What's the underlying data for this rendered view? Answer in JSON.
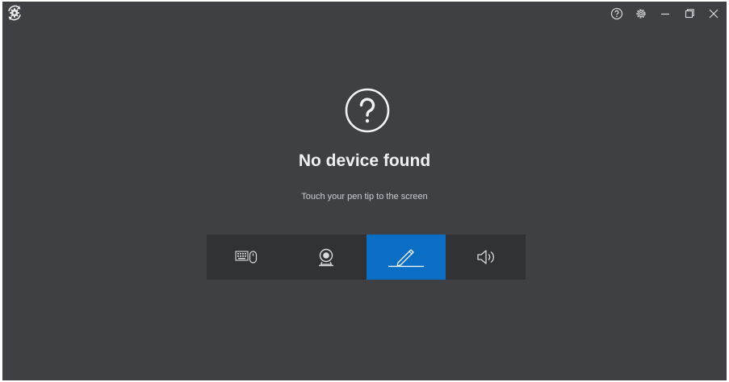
{
  "window": {
    "logo_icon": "gear-sync-icon",
    "controls": [
      {
        "icon": "help-icon"
      },
      {
        "icon": "settings-icon"
      },
      {
        "icon": "minimize-icon"
      },
      {
        "icon": "maximize-icon"
      },
      {
        "icon": "close-icon"
      }
    ]
  },
  "status": {
    "icon": "question-circle-icon",
    "title": "No device found",
    "hint": "Touch your pen tip to the screen"
  },
  "device_tabs": {
    "items": [
      {
        "icon": "keyboard-mouse-icon",
        "active": false
      },
      {
        "icon": "webcam-icon",
        "active": false
      },
      {
        "icon": "pen-icon",
        "active": true
      },
      {
        "icon": "speaker-icon",
        "active": false
      }
    ]
  },
  "colors": {
    "background": "#3e4044",
    "tab_strip": "#313235",
    "accent": "#0a6fc4",
    "text": "#eef0f2"
  }
}
